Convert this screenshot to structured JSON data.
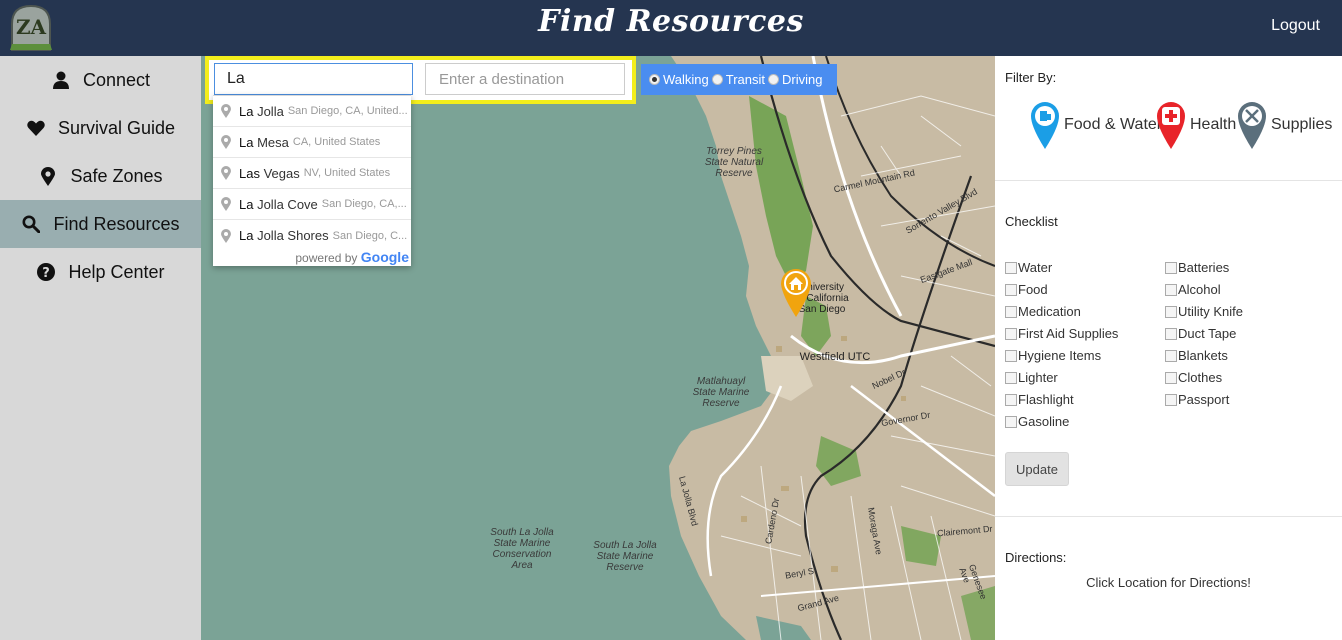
{
  "header": {
    "logo_text": "ZA",
    "title": "Find Resources",
    "logout_label": "Logout"
  },
  "sidebar": {
    "items": [
      {
        "label": "Connect",
        "icon": "user-icon"
      },
      {
        "label": "Survival Guide",
        "icon": "heart-icon"
      },
      {
        "label": "Safe Zones",
        "icon": "map-marker-icon"
      },
      {
        "label": "Find Resources",
        "icon": "search-icon",
        "active": true
      },
      {
        "label": "Help Center",
        "icon": "question-circle-icon"
      }
    ]
  },
  "search": {
    "origin_value": "La",
    "destination_placeholder": "Enter a destination",
    "modes": [
      {
        "label": "Walking",
        "selected": true
      },
      {
        "label": "Transit",
        "selected": false
      },
      {
        "label": "Driving",
        "selected": false
      }
    ],
    "highlight_color": "#f3ee1c"
  },
  "autocomplete": {
    "suggestions": [
      {
        "match": "La",
        "rest": " Jolla",
        "secondary": "San Diego, CA, United..."
      },
      {
        "match": "La",
        "rest": " Mesa",
        "secondary": "CA, United States"
      },
      {
        "match": "Las",
        "rest": " Vegas",
        "secondary": "NV, United States"
      },
      {
        "match": "La",
        "rest": " Jolla Cove",
        "secondary": "San Diego, CA,..."
      },
      {
        "match": "La",
        "rest": " Jolla Shores",
        "secondary": "San Diego, C..."
      }
    ],
    "powered_by": "powered by",
    "brand": "Google"
  },
  "map": {
    "labels": {
      "torrey": "Torrey Pines\nState Natural\nReserve",
      "university": "University\nof California\nSan Diego",
      "westfield": "Westfield UTC",
      "matlahuayl": "Matlahuayl\nState Marine\nReserve",
      "conservation": "South La Jolla\nState Marine\nConservation\nArea",
      "reserve": "South La Jolla\nState Marine\nReserve"
    },
    "roads": [
      "Carmel Mountain Rd",
      "Sorrento Valley Blvd",
      "Eastgate Mall",
      "Nobel Dr",
      "Governor Dr",
      "La Jolla Blvd",
      "Cardeno Dr",
      "Beryl St",
      "Grand Ave",
      "Moraga Ave",
      "Clairemont Dr",
      "Genesee Ave"
    ],
    "water_color": "#7ba396",
    "land_color": "#c8bba4",
    "marker_color": "#f1a40e"
  },
  "filters": {
    "heading": "Filter By:",
    "items": [
      {
        "label": "Food & Water",
        "color": "#1b9ee6",
        "icon": "cup-icon"
      },
      {
        "label": "Health",
        "color": "#e8242a",
        "icon": "cross-icon"
      },
      {
        "label": "Supplies",
        "color": "#5b6f7c",
        "icon": "utensils-icon"
      }
    ]
  },
  "checklist": {
    "heading": "Checklist",
    "left": [
      "Water",
      "Food",
      "Medication",
      "First Aid Supplies",
      "Hygiene Items",
      "Lighter",
      "Flashlight",
      "Gasoline"
    ],
    "right": [
      "Batteries",
      "Alcohol",
      "Utility Knife",
      "Duct Tape",
      "Blankets",
      "Clothes",
      "Passport"
    ],
    "update_label": "Update"
  },
  "directions": {
    "heading": "Directions:",
    "message": "Click Location for Directions!"
  }
}
